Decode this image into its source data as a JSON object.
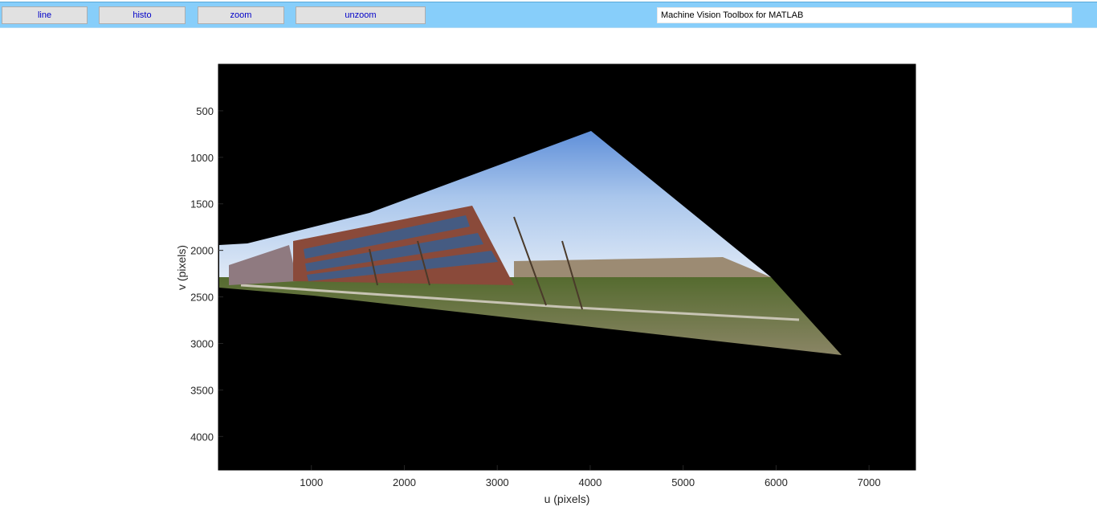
{
  "window": {
    "title": "Machine Vision Toolbox for MATLAB"
  },
  "toolbar": {
    "buttons": [
      {
        "label": "line"
      },
      {
        "label": "histo"
      },
      {
        "label": "zoom"
      },
      {
        "label": "unzoom"
      }
    ]
  },
  "figure": {
    "xlabel": "u (pixels)",
    "ylabel": "v (pixels)",
    "xlim": [
      0,
      7500
    ],
    "ylim": [
      4360,
      0
    ],
    "xticks": [
      1000,
      2000,
      3000,
      4000,
      5000,
      6000,
      7000
    ],
    "yticks": [
      500,
      1000,
      1500,
      2000,
      2500,
      3000,
      3500,
      4000
    ],
    "xtick_labels": [
      "1000",
      "2000",
      "3000",
      "4000",
      "5000",
      "6000",
      "7000"
    ],
    "ytick_labels": [
      "500",
      "1000",
      "1500",
      "2000",
      "2500",
      "3000",
      "3500",
      "4000"
    ],
    "background": "#000000",
    "image": "warped-mosaic-of-office-building",
    "mosaic_outline_uv": [
      [
        0,
        1940
      ],
      [
        300,
        1920
      ],
      [
        1500,
        1650
      ],
      [
        4000,
        720
      ],
      [
        6700,
        3120
      ],
      [
        1000,
        2450
      ],
      [
        0,
        2400
      ]
    ]
  },
  "colors": {
    "toolbar_bg": "#87cefa",
    "button_text": "#0000c8",
    "axis_text": "#262626"
  }
}
